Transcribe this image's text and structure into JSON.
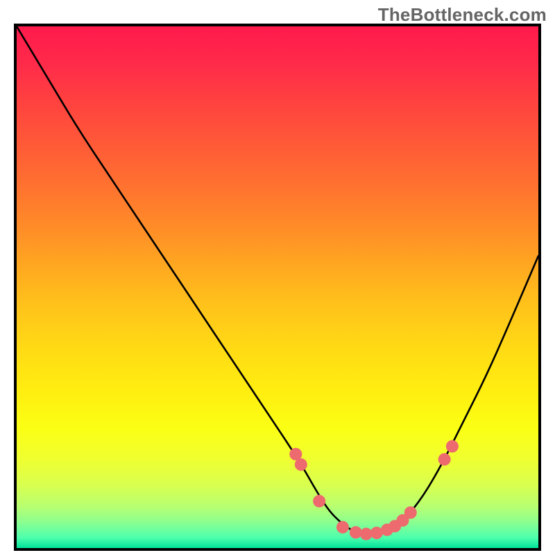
{
  "watermark": "TheBottleneck.com",
  "chart_data": {
    "type": "line",
    "title": "",
    "xlabel": "",
    "ylabel": "",
    "xlim": [
      0,
      100
    ],
    "ylim": [
      0,
      100
    ],
    "series": [
      {
        "name": "curve",
        "x": [
          0,
          6,
          12,
          18,
          24,
          30,
          36,
          42,
          48,
          54,
          58,
          60,
          62,
          64,
          66,
          68,
          70,
          74,
          78,
          82,
          86,
          90,
          94,
          100
        ],
        "y": [
          100,
          90,
          80,
          71,
          62,
          53,
          44,
          35,
          26,
          17,
          10,
          7,
          5,
          3.5,
          2.8,
          2.6,
          3,
          5,
          10,
          17,
          25,
          33,
          42,
          56
        ]
      }
    ],
    "markers": {
      "name": "points",
      "x": [
        53.5,
        54.5,
        58,
        62.5,
        65,
        67,
        69,
        71,
        72.5,
        74,
        75.5,
        82,
        83.5
      ],
      "y": [
        18,
        16,
        9,
        4,
        3,
        2.7,
        2.9,
        3.5,
        4.2,
        5.3,
        6.8,
        17,
        19.5
      ]
    },
    "gradient_stops": [
      {
        "pct": 0,
        "color": "#ff1a4c"
      },
      {
        "pct": 50,
        "color": "#ffc41a"
      },
      {
        "pct": 85,
        "color": "#efff30"
      },
      {
        "pct": 100,
        "color": "#00e29a"
      }
    ]
  }
}
